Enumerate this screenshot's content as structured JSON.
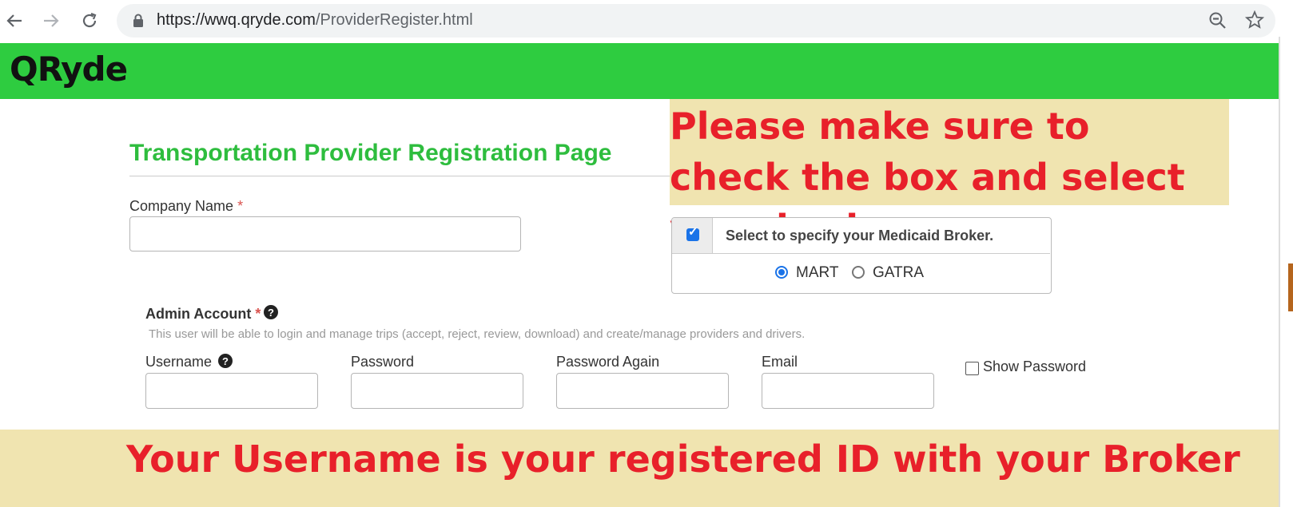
{
  "browser": {
    "url_host": "https://wwq.qryde.com",
    "url_path": "/ProviderRegister.html",
    "icons": [
      "back-arrow-icon",
      "forward-arrow-icon",
      "reload-icon",
      "lock-icon",
      "zoom-out-icon",
      "star-icon"
    ]
  },
  "app": {
    "brand": "QRyde",
    "brand_color": "#2ecc40"
  },
  "page": {
    "title": "Transportation Provider Registration Page",
    "title_color": "#2ebd3e"
  },
  "company": {
    "label": "Company Name",
    "required_mark": "*",
    "value": ""
  },
  "broker": {
    "checkbox_checked": true,
    "label": "Select to specify your Medicaid Broker.",
    "options": [
      {
        "label": "MART",
        "selected": true
      },
      {
        "label": "GATRA",
        "selected": false
      }
    ]
  },
  "admin": {
    "title": "Admin Account",
    "required_mark": "*",
    "description": "This user will be able to login and manage trips (accept, reject, review, download) and create/manage providers and drivers.",
    "fields": {
      "username": {
        "label": "Username",
        "value": ""
      },
      "password": {
        "label": "Password",
        "value": ""
      },
      "password_again": {
        "label": "Password Again",
        "value": ""
      },
      "email": {
        "label": "Email",
        "value": ""
      }
    },
    "show_password": {
      "label": "Show Password",
      "checked": false
    }
  },
  "callouts": {
    "top": "Please make sure to check the box and select your broker",
    "bottom": "Your Username is your registered ID with your Broker",
    "text_color": "#e8202a",
    "background": "#f0e4b0"
  }
}
